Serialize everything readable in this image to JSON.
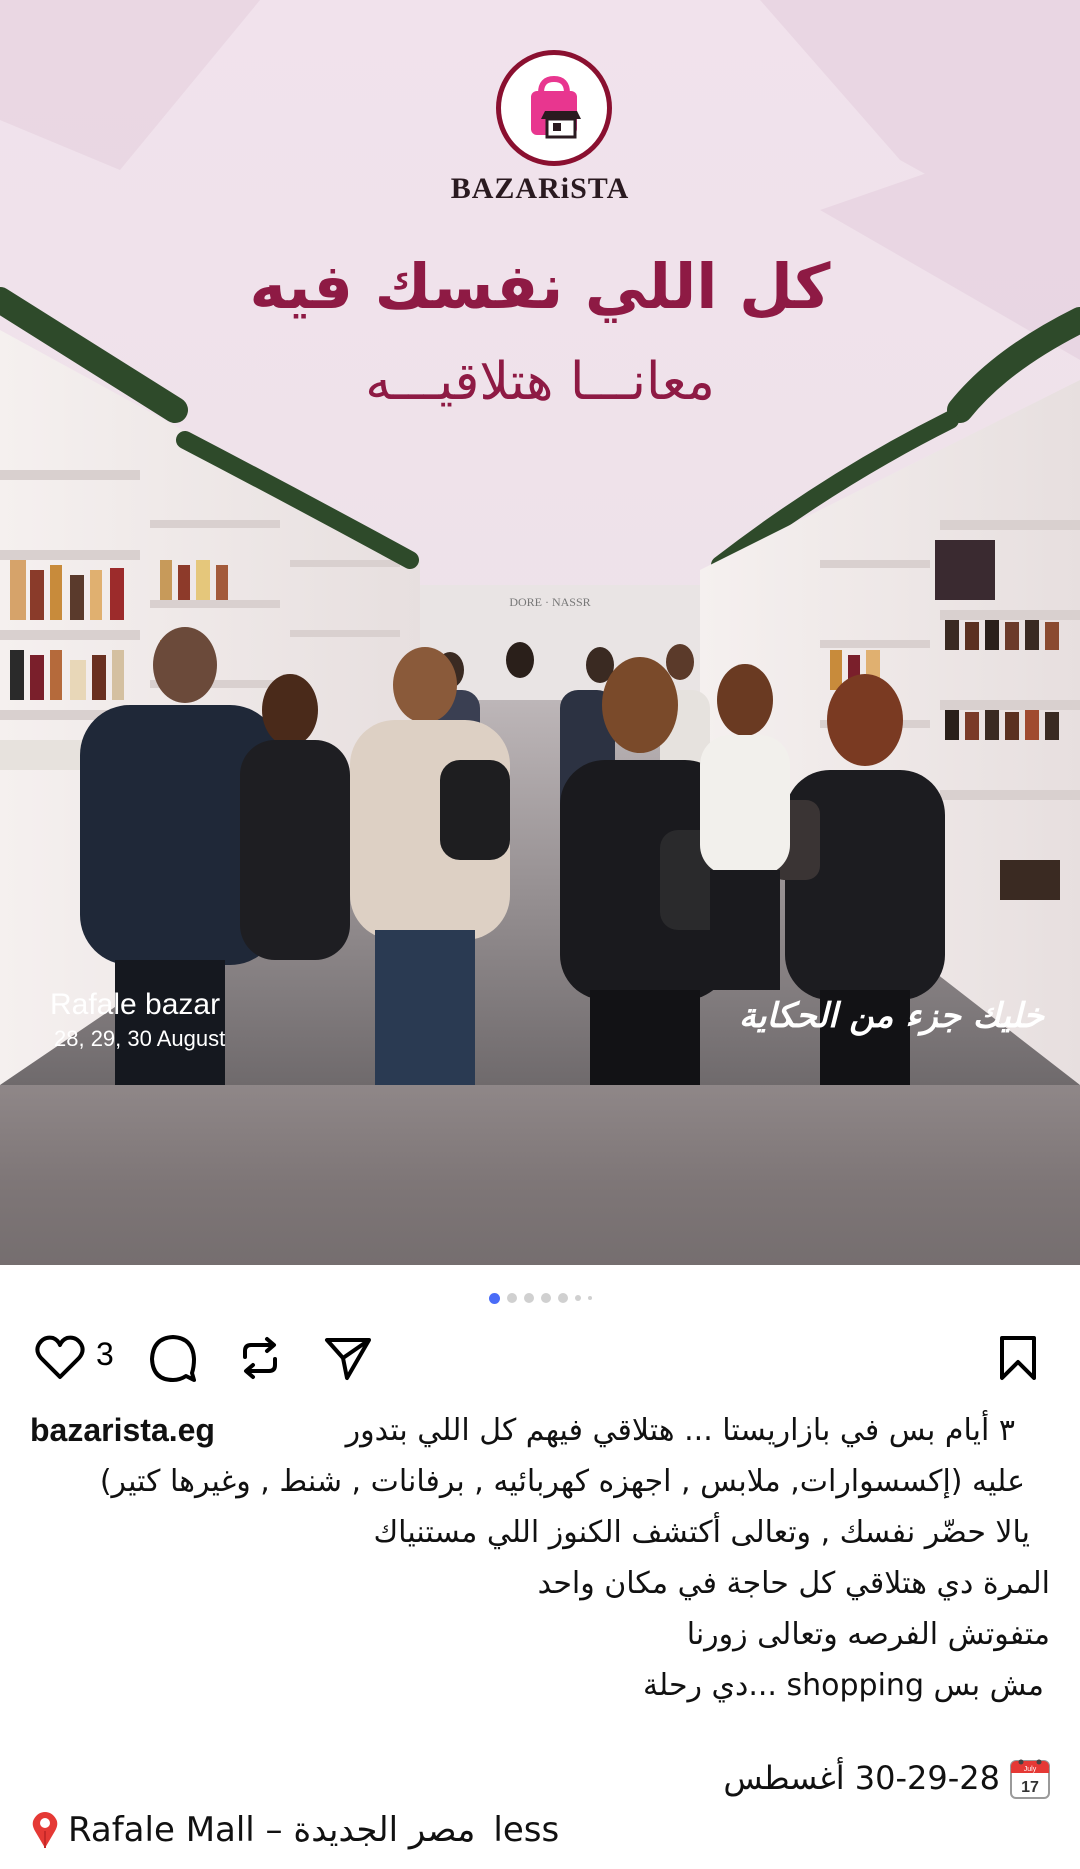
{
  "post_image": {
    "brand": "BAZARiSTA",
    "headline": "كل اللي نفسك فيه",
    "subhead": "معانـــا هتلاقيـــه",
    "bazar_name": "Rafale bazar",
    "bazar_dates": "28, 29, 30 August",
    "tagline": "خليك جزء من الحكاية",
    "colors": {
      "accent": "#8e1a44",
      "logo_ring": "#8a1030",
      "bag": "#e8368f"
    }
  },
  "carousel": {
    "total_slides": 7,
    "active_index": 0
  },
  "actions": {
    "like_icon": "heart-icon",
    "like_count": "3",
    "comment_icon": "comment-icon",
    "repost_icon": "repost-icon",
    "share_icon": "send-icon",
    "save_icon": "bookmark-icon"
  },
  "caption": {
    "username": "bazarista.eg",
    "line1": "٣ أيام بس في بازاريستا ... هتلاقي فيهم كل اللي بتدور",
    "line2": "عليه (إكسسوارات, ملابس , اجهزه كهربائيه , برفانات , شنط , وغيرها كتير)",
    "line3": "يالا حضّر نفسك , وتعالى أكتشف الكنوز اللي مستنياك",
    "line4": "المرة دي هتلاقي كل حاجة في مكان واحد",
    "line5": "متفوتش الفرصه وتعالى زورنا",
    "line6": "مش بس shopping ...دي رحلة",
    "date_text": "30-29-28 أغسطس",
    "calendar_month": "July",
    "calendar_day": "17",
    "location_text": "Rafale Mall – مصر الجديدة",
    "less_label": "less"
  }
}
